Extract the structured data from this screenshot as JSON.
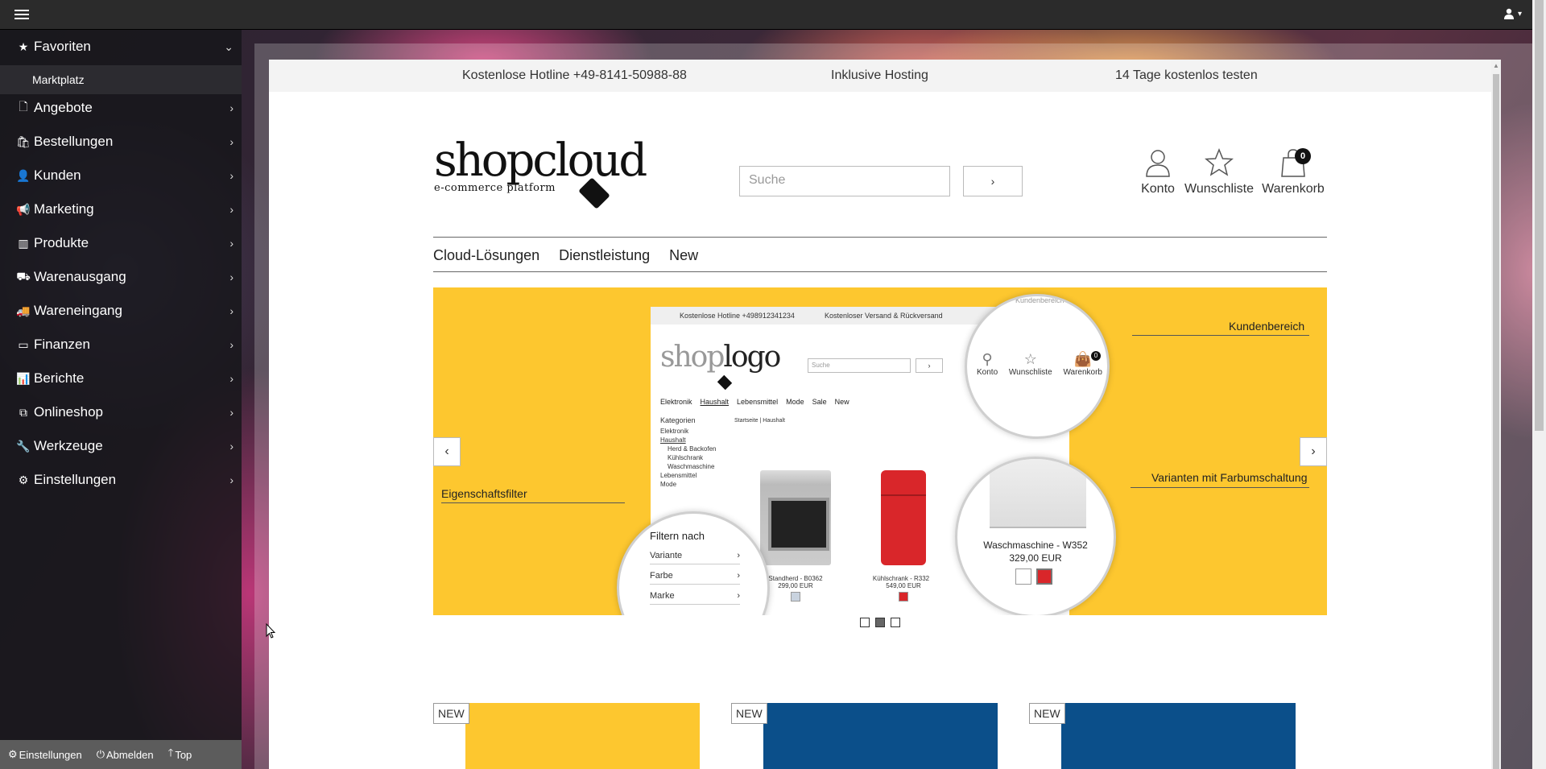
{
  "topbar": {
    "user_icon": "user-icon",
    "caret": "▾"
  },
  "sidebar": {
    "items": [
      {
        "icon": "★",
        "label": "Favoriten",
        "expanded": true
      },
      {
        "icon": "🗋",
        "label": "Angebote"
      },
      {
        "icon": "🛍",
        "label": "Bestellungen"
      },
      {
        "icon": "👤",
        "label": "Kunden"
      },
      {
        "icon": "📢",
        "label": "Marketing"
      },
      {
        "icon": "▥",
        "label": "Produkte"
      },
      {
        "icon": "⛟",
        "label": "Warenausgang"
      },
      {
        "icon": "🚚",
        "label": "Wareneingang"
      },
      {
        "icon": "▭",
        "label": "Finanzen"
      },
      {
        "icon": "📊",
        "label": "Berichte"
      },
      {
        "icon": "⧉",
        "label": "Onlineshop"
      },
      {
        "icon": "🔧",
        "label": "Werkzeuge"
      },
      {
        "icon": "⚙",
        "label": "Einstellungen"
      }
    ],
    "sub_item": "Marktplatz",
    "footer": {
      "settings": "Einstellungen",
      "logout": "Abmelden",
      "top": "Top"
    }
  },
  "shop": {
    "infobar": {
      "hotline": "Kostenlose Hotline +49-8141-50988-88",
      "hosting": "Inklusive Hosting",
      "trial": "14 Tage kostenlos testen"
    },
    "logo": {
      "main": "shopcloud",
      "sub": "e-commerce platform"
    },
    "search": {
      "placeholder": "Suche",
      "button": "›"
    },
    "header_icons": {
      "account": "Konto",
      "wishlist": "Wunschliste",
      "cart": "Warenkorb",
      "cart_count": "0"
    },
    "nav": [
      "Cloud-Lösungen",
      "Dienstleistung",
      "New"
    ],
    "slider": {
      "mock": {
        "hotline": "Kostenlose Hotline +498912341234",
        "shipping": "Kostenloser Versand & Rückversand",
        "logo_light": "shop",
        "logo_dark": "logo",
        "search": "Suche",
        "search_btn": "›",
        "nav": [
          "Elektronik",
          "Haushalt",
          "Lebensmittel",
          "Mode",
          "Sale",
          "New"
        ],
        "categories_title": "Kategorien",
        "categories": [
          "Elektronik",
          "Haushalt",
          "Herd & Backofen",
          "Kühlschrank",
          "Waschmaschine",
          "Lebensmittel",
          "Mode"
        ],
        "breadcrumb": "Startseite | Haushalt",
        "products": [
          {
            "name": "Standherd - B0362",
            "price": "299,00 EUR"
          },
          {
            "name": "Kühlschrank - R332",
            "price": "549,00 EUR"
          }
        ]
      },
      "circle_account": {
        "top_text": "Kundenbereich",
        "konto": "Konto",
        "wunschliste": "Wunschliste",
        "warenkorb": "Warenkorb",
        "count": "0"
      },
      "circle_filter": {
        "title": "Filtern nach",
        "rows": [
          "Variante",
          "Farbe",
          "Marke"
        ]
      },
      "circle_variant": {
        "name": "Waschmaschine - W352",
        "price": "329,00 EUR"
      },
      "callouts": {
        "customer": "Kundenbereich",
        "filter": "Eigenschaftsfilter",
        "variants": "Varianten mit Farbumschaltung"
      },
      "prev": "‹",
      "next": "›",
      "dots_active": 2
    },
    "cards": [
      {
        "badge": "NEW",
        "color": "#fdc72f"
      },
      {
        "badge": "NEW",
        "color": "#0b4f8a"
      },
      {
        "badge": "NEW",
        "color": "#0b4f8a"
      }
    ]
  }
}
